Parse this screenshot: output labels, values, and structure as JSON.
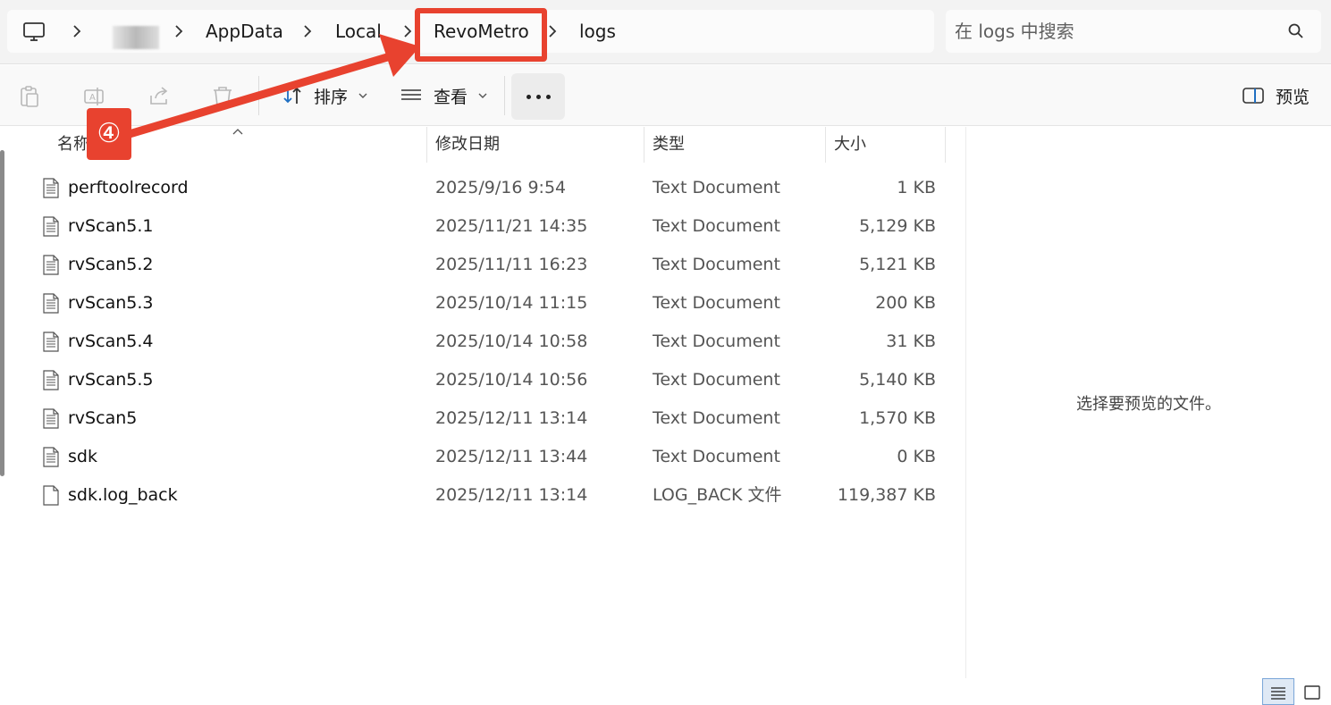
{
  "breadcrumb": {
    "items": [
      "AppData",
      "Local",
      "RevoMetro",
      "logs"
    ]
  },
  "search": {
    "placeholder": "在 logs 中搜索"
  },
  "toolbar": {
    "sort_label": "排序",
    "view_label": "查看",
    "preview_label": "预览"
  },
  "columns": {
    "name": "名称",
    "date": "修改日期",
    "type": "类型",
    "size": "大小"
  },
  "files": [
    {
      "name": "perftoolrecord",
      "date": "2025/9/16 9:54",
      "type": "Text Document",
      "size": "1 KB"
    },
    {
      "name": "rvScan5.1",
      "date": "2025/11/21 14:35",
      "type": "Text Document",
      "size": "5,129 KB"
    },
    {
      "name": "rvScan5.2",
      "date": "2025/11/11 16:23",
      "type": "Text Document",
      "size": "5,121 KB"
    },
    {
      "name": "rvScan5.3",
      "date": "2025/10/14 11:15",
      "type": "Text Document",
      "size": "200 KB"
    },
    {
      "name": "rvScan5.4",
      "date": "2025/10/14 10:58",
      "type": "Text Document",
      "size": "31 KB"
    },
    {
      "name": "rvScan5.5",
      "date": "2025/10/14 10:56",
      "type": "Text Document",
      "size": "5,140 KB"
    },
    {
      "name": "rvScan5",
      "date": "2025/12/11 13:14",
      "type": "Text Document",
      "size": "1,570 KB"
    },
    {
      "name": "sdk",
      "date": "2025/12/11 13:44",
      "type": "Text Document",
      "size": "0 KB"
    },
    {
      "name": "sdk.log_back",
      "date": "2025/12/11 13:14",
      "type": "LOG_BACK 文件",
      "size": "119,387 KB"
    }
  ],
  "preview": {
    "message": "选择要预览的文件。"
  },
  "annotation": {
    "step_label": "④",
    "color": "#e8422f"
  },
  "colors": {
    "accent": "#1f6fc2",
    "annotation": "#e8422f"
  }
}
